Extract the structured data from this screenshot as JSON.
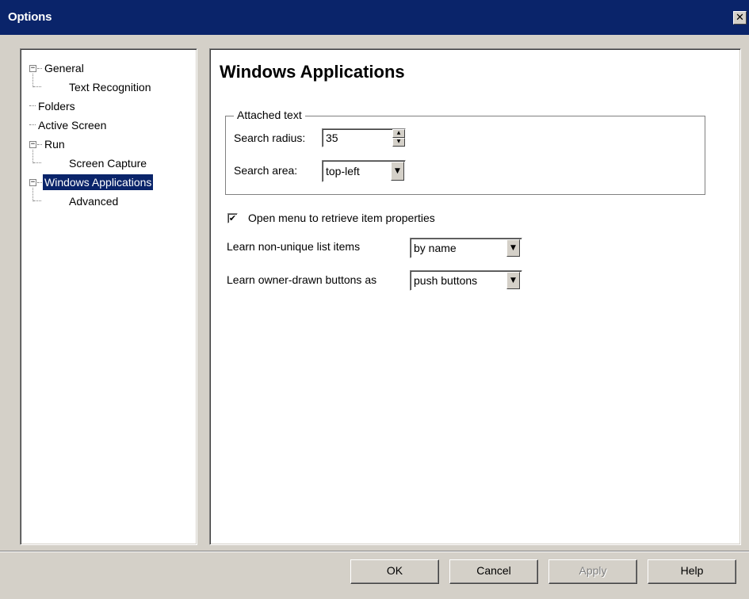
{
  "window": {
    "title": "Options",
    "close_glyph": "✕"
  },
  "tree": {
    "items": [
      {
        "label": "General",
        "expander": "−"
      },
      {
        "label": "Text Recognition"
      },
      {
        "label": "Folders"
      },
      {
        "label": "Active Screen"
      },
      {
        "label": "Run",
        "expander": "−"
      },
      {
        "label": "Screen Capture"
      },
      {
        "label": "Windows Applications",
        "expander": "−",
        "selected": true
      },
      {
        "label": "Advanced"
      }
    ]
  },
  "content": {
    "heading": "Windows Applications",
    "attached_text": {
      "legend": "Attached text",
      "search_radius_label": "Search radius:",
      "search_radius_value": "35",
      "search_area_label": "Search area:",
      "search_area_value": "top-left"
    },
    "open_menu": {
      "checked_glyph": "✔",
      "label": "Open menu to retrieve item properties"
    },
    "non_unique": {
      "label": "Learn non-unique list items",
      "value": "by name"
    },
    "owner_drawn": {
      "label": "Learn owner-drawn buttons as",
      "value": "push buttons"
    }
  },
  "icons": {
    "spin_up": "▲",
    "spin_down": "▼",
    "dropdown": "▼"
  },
  "buttons": {
    "ok": "OK",
    "cancel": "Cancel",
    "apply": "Apply",
    "help": "Help"
  },
  "colors": {
    "titlebar": "#0a246a",
    "selection": "#0a246a",
    "face": "#d4d0c8"
  }
}
